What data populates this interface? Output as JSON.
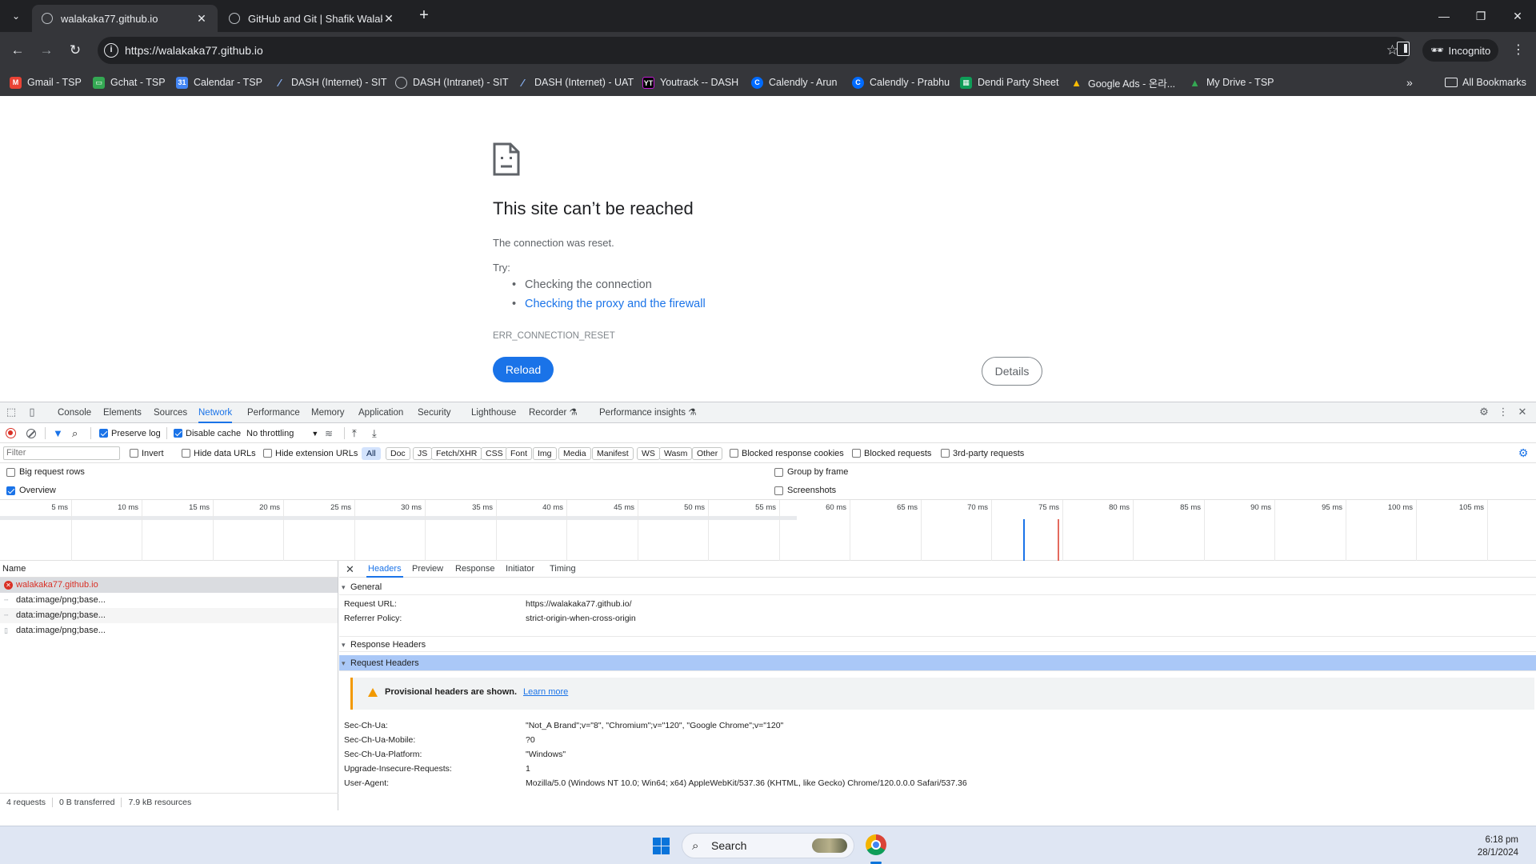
{
  "browser": {
    "tabs": [
      {
        "title": "walakaka77.github.io",
        "active": true
      },
      {
        "title": "GitHub and Git | Shafik Walakaka",
        "active": false
      }
    ],
    "new_tab": "+",
    "url": "https://walakaka77.github.io",
    "profile_label": "Incognito",
    "bookmarks": [
      {
        "label": "Gmail - TSP",
        "icon": "gmail-icon",
        "color": "#ea4335"
      },
      {
        "label": "Gchat - TSP",
        "icon": "gchat-icon",
        "color": "#34a853"
      },
      {
        "label": "Calendar - TSP",
        "icon": "calendar-icon",
        "color": "#4285f4"
      },
      {
        "label": "DASH (Internet) - SIT",
        "icon": "dash-icon",
        "color": "#8ab4f8"
      },
      {
        "label": "DASH (Intranet) - SIT",
        "icon": "globe-icon",
        "color": "#9aa0a6"
      },
      {
        "label": "DASH (Internet) - UAT",
        "icon": "dash-icon",
        "color": "#8ab4f8"
      },
      {
        "label": "Youtrack -- DASH",
        "icon": "youtrack-icon",
        "color": "#c21ad3"
      },
      {
        "label": "Calendly - Arun",
        "icon": "calendly-icon",
        "color": "#006bff"
      },
      {
        "label": "Calendly - Prabhu",
        "icon": "calendly-icon",
        "color": "#006bff"
      },
      {
        "label": "Dendi Party Sheet",
        "icon": "sheets-icon",
        "color": "#0f9d58"
      },
      {
        "label": "Google Ads - 온라...",
        "icon": "google-ads-icon",
        "color": "#fbbc04"
      },
      {
        "label": "My Drive - TSP",
        "icon": "drive-icon",
        "color": "#34a853"
      }
    ],
    "more_bookmarks": "»",
    "all_bookmarks": "All Bookmarks"
  },
  "error_page": {
    "title": "This site can’t be reached",
    "subtitle": "The connection was reset.",
    "try_label": "Try:",
    "suggestions": [
      {
        "text": "Checking the connection",
        "link": false
      },
      {
        "text": "Checking the proxy and the firewall",
        "link": true
      }
    ],
    "error_code": "ERR_CONNECTION_RESET",
    "reload_label": "Reload",
    "details_label": "Details"
  },
  "devtools": {
    "tabs": [
      "Console",
      "Elements",
      "Sources",
      "Network",
      "Performance",
      "Memory",
      "Application",
      "Security",
      "Lighthouse",
      "Recorder",
      "Performance insights"
    ],
    "active_tab": "Network",
    "toolbar": {
      "preserve_log": "Preserve log",
      "preserve_log_checked": true,
      "disable_cache": "Disable cache",
      "disable_cache_checked": true,
      "throttling": "No throttling"
    },
    "filter": {
      "placeholder": "Filter",
      "invert": "Invert",
      "hide_data_urls": "Hide data URLs",
      "hide_extension_urls": "Hide extension URLs",
      "types": [
        "All",
        "Doc",
        "JS",
        "Fetch/XHR",
        "CSS",
        "Font",
        "Img",
        "Media",
        "Manifest",
        "WS",
        "Wasm",
        "Other"
      ],
      "selected_type": "All",
      "blocked_cookies": "Blocked response cookies",
      "blocked_requests": "Blocked requests",
      "third_party": "3rd-party requests"
    },
    "options": {
      "big_rows": "Big request rows",
      "big_rows_checked": false,
      "overview": "Overview",
      "overview_checked": true,
      "group_by_frame": "Group by frame",
      "screenshots": "Screenshots"
    },
    "timeline_ticks": [
      "5 ms",
      "10 ms",
      "15 ms",
      "20 ms",
      "25 ms",
      "30 ms",
      "35 ms",
      "40 ms",
      "45 ms",
      "50 ms",
      "55 ms",
      "60 ms",
      "65 ms",
      "70 ms",
      "75 ms",
      "80 ms",
      "85 ms",
      "90 ms",
      "95 ms",
      "100 ms",
      "105 ms"
    ],
    "requests": {
      "header": "Name",
      "rows": [
        {
          "name": "walakaka77.github.io",
          "status": "error"
        },
        {
          "name": "data:image/png;base...",
          "status": "ok"
        },
        {
          "name": "data:image/png;base...",
          "status": "ok"
        },
        {
          "name": "data:image/png;base...",
          "status": "ok"
        }
      ],
      "footer": [
        "4 requests",
        "0 B transferred",
        "7.9 kB resources"
      ]
    },
    "details": {
      "tabs": [
        "Headers",
        "Preview",
        "Response",
        "Initiator",
        "Timing"
      ],
      "active_tab": "Headers",
      "general_label": "General",
      "general": [
        {
          "key": "Request URL:",
          "value": "https://walakaka77.github.io/"
        },
        {
          "key": "Referrer Policy:",
          "value": "strict-origin-when-cross-origin"
        }
      ],
      "response_headers_label": "Response Headers",
      "request_headers_label": "Request Headers",
      "warning": "Provisional headers are shown.",
      "learn_more": "Learn more",
      "request_headers": [
        {
          "key": "Sec-Ch-Ua:",
          "value": "\"Not_A Brand\";v=\"8\", \"Chromium\";v=\"120\", \"Google Chrome\";v=\"120\""
        },
        {
          "key": "Sec-Ch-Ua-Mobile:",
          "value": "?0"
        },
        {
          "key": "Sec-Ch-Ua-Platform:",
          "value": "\"Windows\""
        },
        {
          "key": "Upgrade-Insecure-Requests:",
          "value": "1"
        },
        {
          "key": "User-Agent:",
          "value": "Mozilla/5.0 (Windows NT 10.0; Win64; x64) AppleWebKit/537.36 (KHTML, like Gecko) Chrome/120.0.0.0 Safari/537.36"
        }
      ]
    }
  },
  "taskbar": {
    "search_label": "Search",
    "time": "6:18 pm",
    "date": "28/1/2024"
  }
}
